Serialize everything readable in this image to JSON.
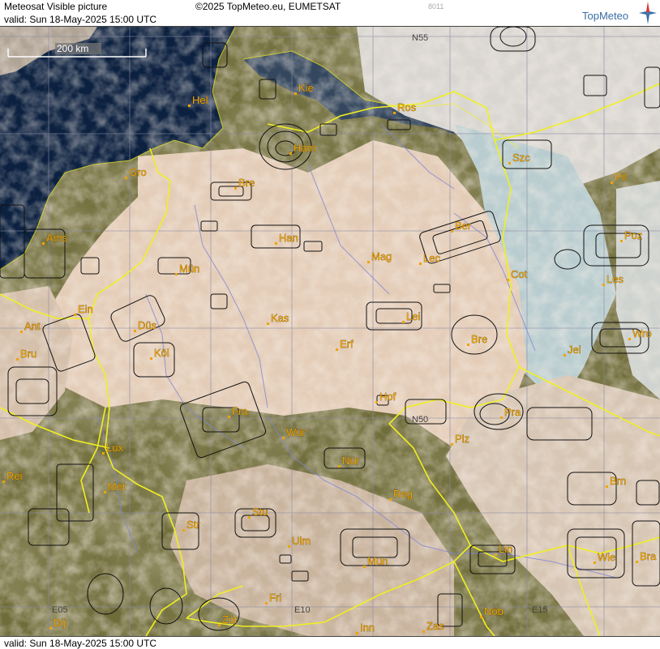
{
  "header": {
    "title": "Meteosat Visible picture",
    "valid": "valid:  Sun  18-May-2025  15:00 UTC",
    "copyright": "©2025 TopMeteo.eu, EUMETSAT",
    "image_code": "8011",
    "logo": "TopMeteo"
  },
  "footer": {
    "valid": "valid:  Sun  18-May-2025  15:00 UTC"
  },
  "scale_bar": {
    "label": "200 km"
  },
  "grid_labels": {
    "n55": "N55",
    "n50": "N50",
    "e05": "E05",
    "e10": "E10",
    "e15": "E15"
  },
  "cities": [
    {
      "id": "hel",
      "label": "Hel"
    },
    {
      "id": "kie",
      "label": "Kie"
    },
    {
      "id": "ros",
      "label": "Ros"
    },
    {
      "id": "ham",
      "label": "Ham"
    },
    {
      "id": "szc",
      "label": "Szc"
    },
    {
      "id": "gro",
      "label": "Gro"
    },
    {
      "id": "bre1",
      "label": "Bre"
    },
    {
      "id": "pil",
      "label": "Pil"
    },
    {
      "id": "ber",
      "label": "Ber"
    },
    {
      "id": "ams",
      "label": "Ams"
    },
    {
      "id": "han",
      "label": "Han"
    },
    {
      "id": "poz",
      "label": "Poz"
    },
    {
      "id": "mag",
      "label": "Mag"
    },
    {
      "id": "lec",
      "label": "Lec"
    },
    {
      "id": "mun1",
      "label": "Mün"
    },
    {
      "id": "cot",
      "label": "Cot"
    },
    {
      "id": "les",
      "label": "Les"
    },
    {
      "id": "ein",
      "label": "Ein"
    },
    {
      "id": "kas",
      "label": "Kas"
    },
    {
      "id": "lei",
      "label": "Lei"
    },
    {
      "id": "ant",
      "label": "Ant"
    },
    {
      "id": "dus",
      "label": "Düs"
    },
    {
      "id": "bre2",
      "label": "Bre"
    },
    {
      "id": "wro",
      "label": "Wro"
    },
    {
      "id": "erf",
      "label": "Erf"
    },
    {
      "id": "bru",
      "label": "Bru"
    },
    {
      "id": "kol",
      "label": "Köl"
    },
    {
      "id": "jel",
      "label": "Jel"
    },
    {
      "id": "hof",
      "label": "Hof"
    },
    {
      "id": "fra",
      "label": "Fra"
    },
    {
      "id": "pra",
      "label": "Pra"
    },
    {
      "id": "wur",
      "label": "Wür"
    },
    {
      "id": "plz",
      "label": "Plz"
    },
    {
      "id": "lux",
      "label": "Lux"
    },
    {
      "id": "nur",
      "label": "Nür"
    },
    {
      "id": "rei",
      "label": "Rei"
    },
    {
      "id": "brn",
      "label": "Brn"
    },
    {
      "id": "met",
      "label": "Met"
    },
    {
      "id": "reg",
      "label": "Reg"
    },
    {
      "id": "stu",
      "label": "Stu"
    },
    {
      "id": "str",
      "label": "Str"
    },
    {
      "id": "lin",
      "label": "Lin"
    },
    {
      "id": "ulm",
      "label": "Ulm"
    },
    {
      "id": "mun2",
      "label": "Mün"
    },
    {
      "id": "wie",
      "label": "Wie"
    },
    {
      "id": "bra",
      "label": "Bra"
    },
    {
      "id": "fri",
      "label": "Fri"
    },
    {
      "id": "dij",
      "label": "Dij"
    },
    {
      "id": "zur",
      "label": "Zür"
    },
    {
      "id": "inn",
      "label": "Inn"
    },
    {
      "id": "zas",
      "label": "Zas"
    },
    {
      "id": "nob",
      "label": "Nöb"
    }
  ]
}
